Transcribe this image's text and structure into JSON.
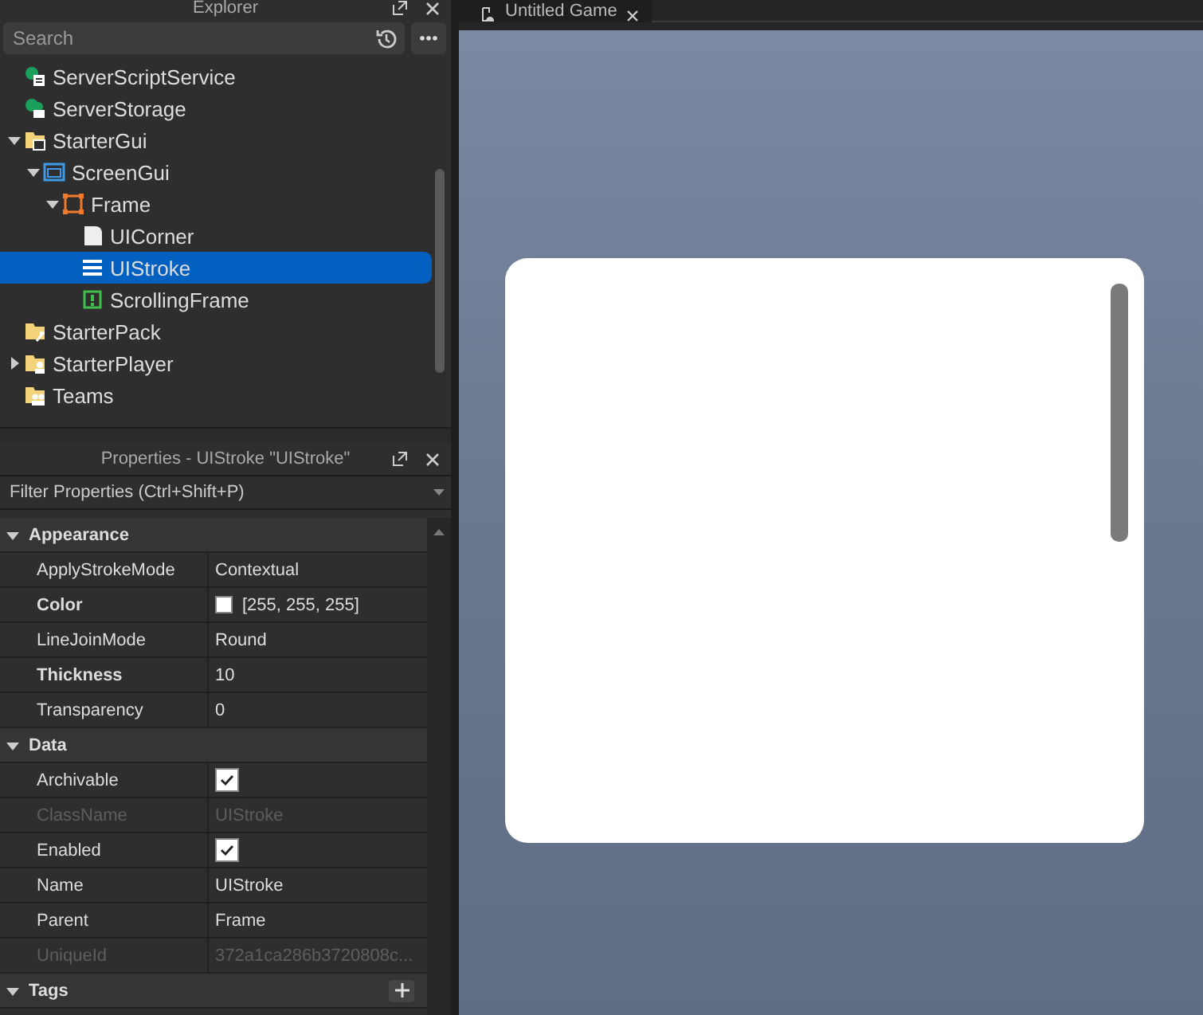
{
  "explorer": {
    "title": "Explorer",
    "search": {
      "placeholder": "Search"
    },
    "tree": [
      {
        "name": "ServerScriptService",
        "kind": "script-service",
        "selected": false
      },
      {
        "name": "ServerStorage",
        "kind": "storage",
        "selected": false
      },
      {
        "name": "StarterGui",
        "kind": "starter-gui",
        "expanded": true,
        "selected": false,
        "children": [
          {
            "name": "ScreenGui",
            "kind": "screen-gui",
            "expanded": true,
            "selected": false,
            "children": [
              {
                "name": "Frame",
                "kind": "frame",
                "expanded": true,
                "selected": false,
                "children": [
                  {
                    "name": "UICorner",
                    "kind": "corner",
                    "selected": false
                  },
                  {
                    "name": "UIStroke",
                    "kind": "stroke",
                    "selected": true
                  },
                  {
                    "name": "ScrollingFrame",
                    "kind": "scrolling-frame",
                    "selected": false
                  }
                ]
              }
            ]
          }
        ]
      },
      {
        "name": "StarterPack",
        "kind": "starter-pack",
        "selected": false
      },
      {
        "name": "StarterPlayer",
        "kind": "starter-player",
        "expanded": false,
        "selected": false
      },
      {
        "name": "Teams",
        "kind": "teams",
        "selected": false
      }
    ]
  },
  "properties": {
    "title": "Properties - UIStroke \"UIStroke\"",
    "filter": {
      "placeholder": "Filter Properties (Ctrl+Shift+P)"
    },
    "categories": [
      {
        "name": "Appearance",
        "expanded": true,
        "items": [
          {
            "name": "ApplyStrokeMode",
            "kind": "text",
            "value": "Contextual",
            "bold": false,
            "disabled": false
          },
          {
            "name": "Color",
            "kind": "color",
            "value": "[255, 255, 255]",
            "color": "#ffffff",
            "bold": true,
            "disabled": false
          },
          {
            "name": "LineJoinMode",
            "kind": "text",
            "value": "Round",
            "bold": false,
            "disabled": false
          },
          {
            "name": "Thickness",
            "kind": "text",
            "value": "10",
            "bold": true,
            "disabled": false
          },
          {
            "name": "Transparency",
            "kind": "text",
            "value": "0",
            "bold": false,
            "disabled": false
          }
        ]
      },
      {
        "name": "Data",
        "expanded": true,
        "items": [
          {
            "name": "Archivable",
            "kind": "checkbox",
            "checked": true,
            "bold": false,
            "disabled": false
          },
          {
            "name": "ClassName",
            "kind": "text",
            "value": "UIStroke",
            "bold": false,
            "disabled": true
          },
          {
            "name": "Enabled",
            "kind": "checkbox",
            "checked": true,
            "bold": false,
            "disabled": false
          },
          {
            "name": "Name",
            "kind": "text",
            "value": "UIStroke",
            "bold": false,
            "disabled": false
          },
          {
            "name": "Parent",
            "kind": "text",
            "value": "Frame",
            "bold": false,
            "disabled": false
          },
          {
            "name": "UniqueId",
            "kind": "text",
            "value": "372a1ca286b3720808c...",
            "bold": false,
            "disabled": true
          }
        ]
      },
      {
        "name": "Tags",
        "expanded": true,
        "addable": true
      }
    ]
  },
  "viewport": {
    "tab": {
      "title": "Untitled Game"
    }
  }
}
